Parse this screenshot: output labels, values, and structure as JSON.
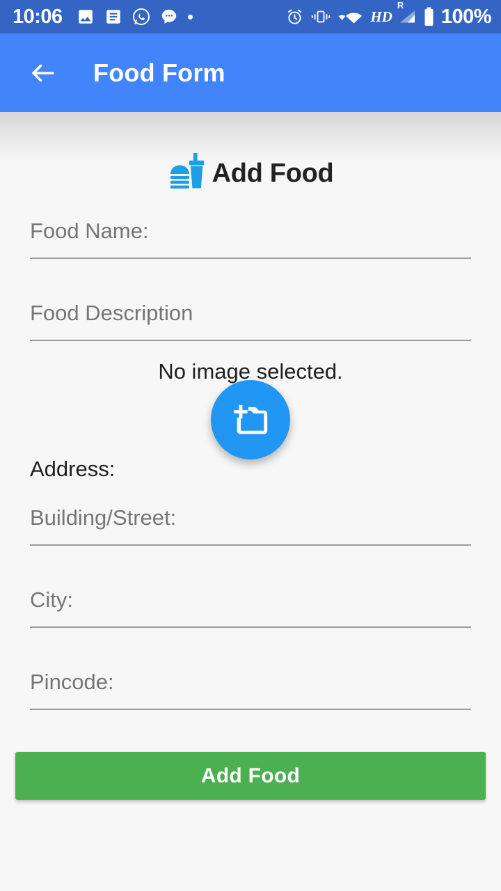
{
  "status_bar": {
    "time": "10:06",
    "battery_percent": "100%",
    "hd_label": "HD",
    "roaming_label": "R",
    "left_icons": [
      "photo-icon",
      "article-icon",
      "whatsapp-icon",
      "chat-bubble-icon",
      "dot-icon"
    ],
    "right_icons": [
      "alarm-icon",
      "vibrate-icon",
      "wifi-icon",
      "signal-icon",
      "battery-icon"
    ],
    "background_color": "#3465c4"
  },
  "app_bar": {
    "title": "Food Form",
    "back_label": "Back",
    "background_color": "#4285fb"
  },
  "header": {
    "brand_title": "Add Food",
    "logo_icon": "burger-drink-logo",
    "logo_color": "#1ca0e3"
  },
  "form": {
    "food_name": {
      "placeholder": "Food Name:",
      "value": ""
    },
    "food_description": {
      "placeholder": "Food Description",
      "value": ""
    },
    "address_label": "Address:",
    "building_street": {
      "placeholder": "Building/Street:",
      "value": ""
    },
    "city": {
      "placeholder": "City:",
      "value": ""
    },
    "pincode": {
      "placeholder": "Pincode:",
      "value": ""
    }
  },
  "image_picker": {
    "status_text": "No image selected.",
    "fab_icon": "add-a-photo-icon",
    "fab_color": "#2196f3"
  },
  "submit": {
    "label": "Add Food",
    "color": "#4caf50"
  }
}
